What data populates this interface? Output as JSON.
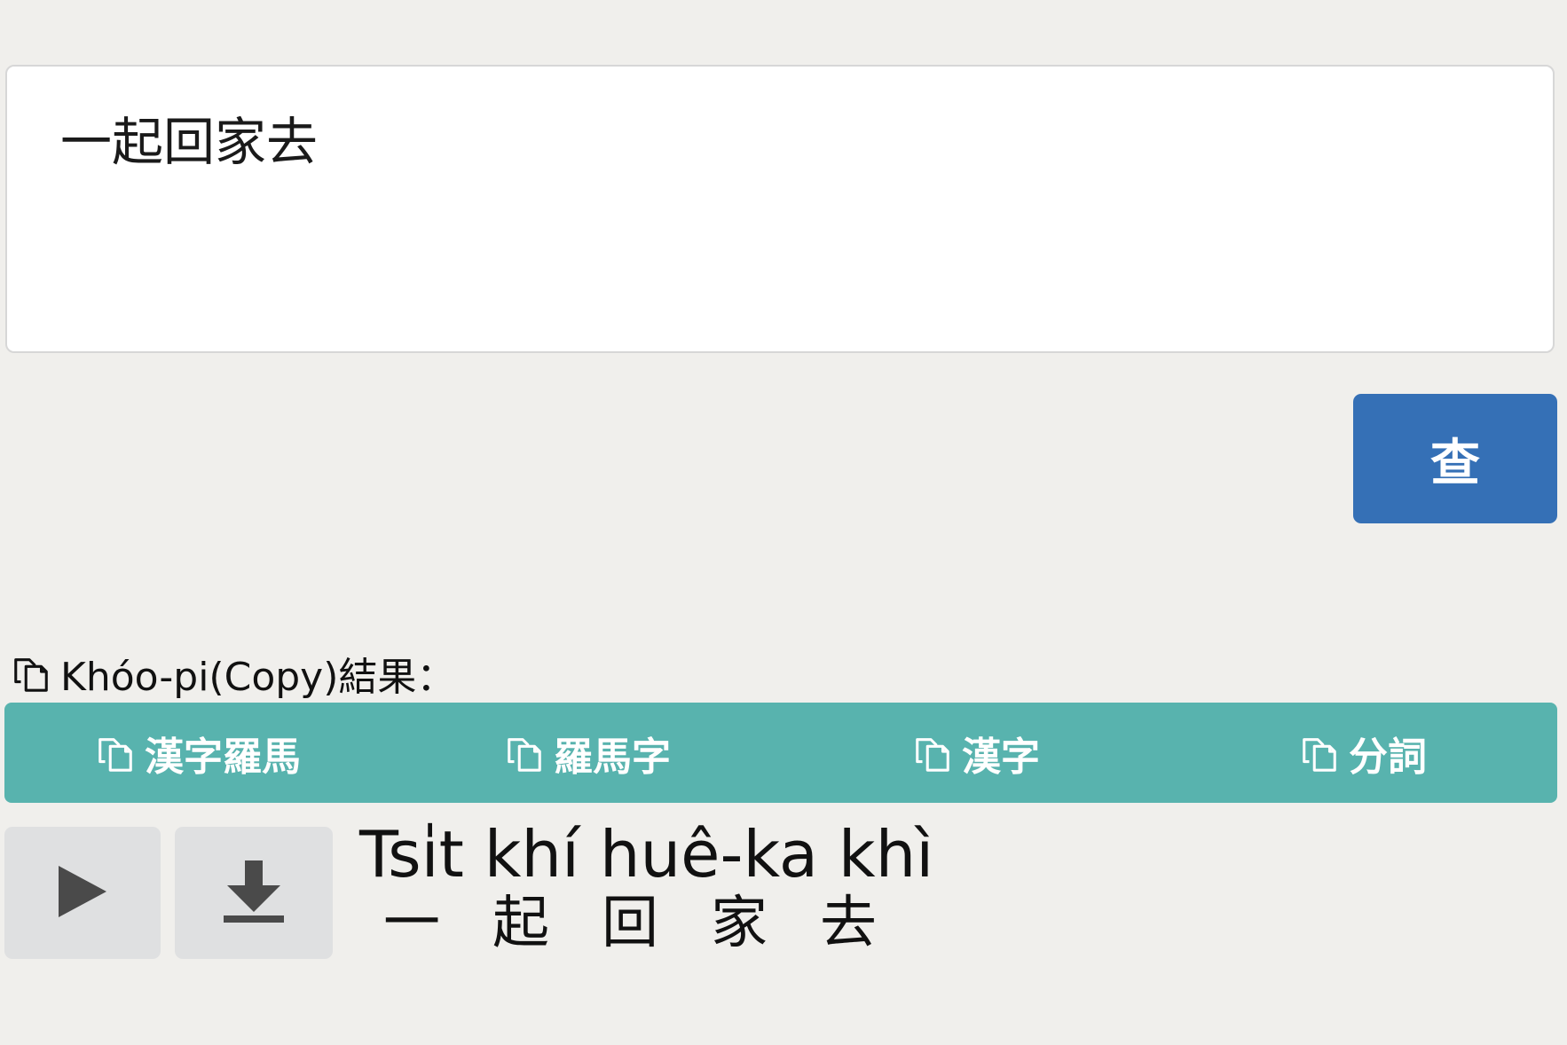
{
  "input": {
    "value": "一起回家去"
  },
  "search_button": {
    "label": "查"
  },
  "copy_section": {
    "label": "Khóo-pi(Copy)結果："
  },
  "copy_buttons": [
    {
      "label": "漢字羅馬"
    },
    {
      "label": "羅馬字"
    },
    {
      "label": "漢字"
    },
    {
      "label": "分詞"
    }
  ],
  "icons": {
    "copy": "copy-icon",
    "play": "play-icon",
    "download": "download-icon"
  },
  "colors": {
    "search_button_bg": "#3570b6",
    "copy_bar_bg": "#58b3ae",
    "media_button_bg": "#dfe0e1"
  },
  "result": {
    "romanized": "Tsi̍t khí huê-ka khì",
    "characters": [
      "一",
      "起",
      "回",
      "家",
      "去"
    ]
  }
}
